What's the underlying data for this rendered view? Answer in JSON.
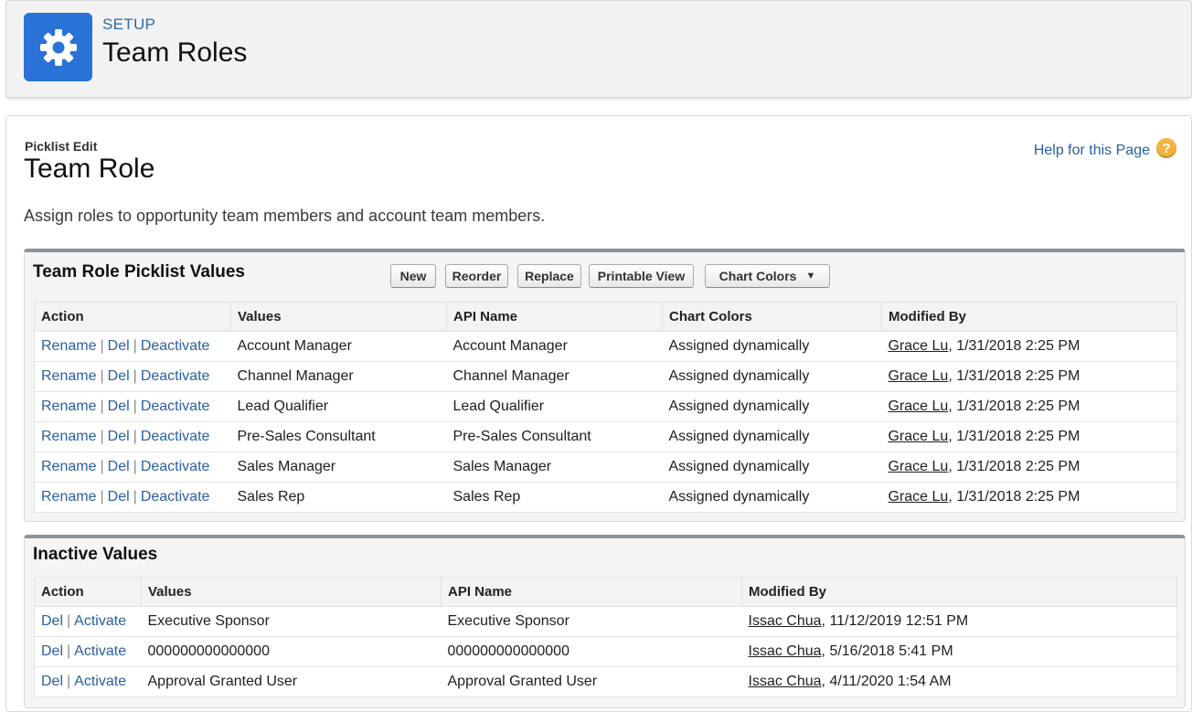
{
  "header": {
    "eyebrow": "SETUP",
    "title": "Team Roles",
    "icon": "gear-icon",
    "icon_color": "#2a72d6"
  },
  "page": {
    "eyebrow": "Picklist Edit",
    "title": "Team Role",
    "help_link": "Help for this Page",
    "help_icon": "?",
    "description": "Assign roles to opportunity team members and account team members."
  },
  "active_section": {
    "title": "Team Role Picklist Values",
    "buttons": {
      "new": "New",
      "reorder": "Reorder",
      "replace": "Replace",
      "printable_view": "Printable View",
      "chart_colors": "Chart Colors",
      "chart_colors_arrow": "▼"
    },
    "columns": {
      "action": "Action",
      "values": "Values",
      "api_name": "API Name",
      "chart_colors": "Chart Colors",
      "modified_by": "Modified By"
    },
    "action_links": {
      "rename": "Rename",
      "del": "Del",
      "deactivate": "Deactivate",
      "sep": "|"
    },
    "rows": [
      {
        "value": "Account Manager",
        "api_name": "Account Manager",
        "chart_color": "Assigned dynamically",
        "user": "Grace Lu",
        "date": ", 1/31/2018 2:25 PM"
      },
      {
        "value": "Channel Manager",
        "api_name": "Channel Manager",
        "chart_color": "Assigned dynamically",
        "user": "Grace Lu",
        "date": ", 1/31/2018 2:25 PM"
      },
      {
        "value": "Lead Qualifier",
        "api_name": "Lead Qualifier",
        "chart_color": "Assigned dynamically",
        "user": "Grace Lu",
        "date": ", 1/31/2018 2:25 PM"
      },
      {
        "value": "Pre-Sales Consultant",
        "api_name": "Pre-Sales Consultant",
        "chart_color": "Assigned dynamically",
        "user": "Grace Lu",
        "date": ", 1/31/2018 2:25 PM"
      },
      {
        "value": "Sales Manager",
        "api_name": "Sales Manager",
        "chart_color": "Assigned dynamically",
        "user": "Grace Lu",
        "date": ", 1/31/2018 2:25 PM"
      },
      {
        "value": "Sales Rep",
        "api_name": "Sales Rep",
        "chart_color": "Assigned dynamically",
        "user": "Grace Lu",
        "date": ", 1/31/2018 2:25 PM"
      }
    ]
  },
  "inactive_section": {
    "title": "Inactive Values",
    "columns": {
      "action": "Action",
      "values": "Values",
      "api_name": "API Name",
      "modified_by": "Modified By"
    },
    "action_links": {
      "del": "Del",
      "activate": "Activate",
      "sep": "|"
    },
    "rows": [
      {
        "value": "Executive Sponsor",
        "api_name": "Executive Sponsor",
        "user": "Issac Chua",
        "date": ", 11/12/2019 12:51 PM"
      },
      {
        "value": "000000000000000",
        "api_name": "000000000000000",
        "user": "Issac Chua",
        "date": ", 5/16/2018 5:41 PM"
      },
      {
        "value": "Approval Granted User",
        "api_name": "Approval Granted User",
        "user": "Issac Chua",
        "date": ", 4/11/2020 1:54 AM"
      }
    ]
  },
  "colors": {
    "link": "#2a5fa3",
    "section_border": "#8a939e",
    "help_icon": "#f2b443"
  }
}
